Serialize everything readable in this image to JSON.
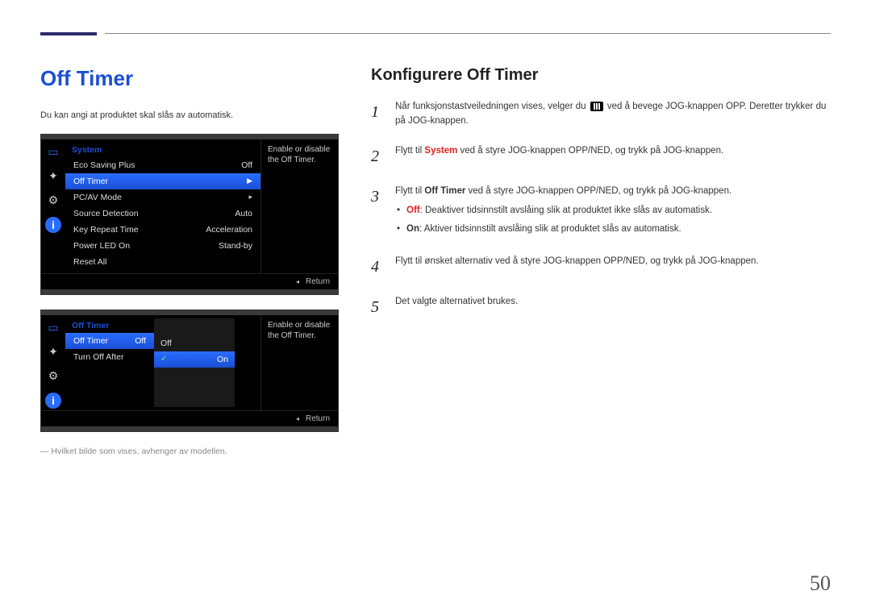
{
  "pageNumber": "50",
  "left": {
    "title": "Off Timer",
    "intro": "Du kan angi at produktet skal slås av automatisk.",
    "footnote": "― Hvilket bilde som vises, avhenger av modellen."
  },
  "osd1": {
    "header": "System",
    "help": "Enable or disable the Off Timer.",
    "rows": [
      {
        "label": "Eco Saving Plus",
        "value": "Off"
      },
      {
        "label": "Off Timer",
        "value": "▶",
        "selected": true
      },
      {
        "label": "PC/AV Mode",
        "value": "▸"
      },
      {
        "label": "Source Detection",
        "value": "Auto"
      },
      {
        "label": "Key Repeat Time",
        "value": "Acceleration"
      },
      {
        "label": "Power LED On",
        "value": "Stand-by"
      },
      {
        "label": "Reset All",
        "value": ""
      }
    ],
    "return": "Return"
  },
  "osd2": {
    "header": "Off Timer",
    "help": "Enable or disable the Off Timer.",
    "colA": [
      {
        "label": "Off Timer",
        "value": "Off",
        "selected": true
      },
      {
        "label": "Turn Off After",
        "value": ""
      }
    ],
    "colB": [
      {
        "label": "Off",
        "selected": false
      },
      {
        "label": "On",
        "selected": true
      }
    ],
    "return": "Return"
  },
  "right": {
    "title": "Konfigurere Off Timer",
    "steps": [
      {
        "n": "1",
        "pre": "Når funksjonstastveiledningen vises, velger du ",
        "post": " ved å bevege JOG-knappen OPP. Deretter trykker du på JOG-knappen.",
        "hasIcon": true
      },
      {
        "n": "2",
        "pre": "Flytt til ",
        "kw": "System",
        "post": " ved å styre JOG-knappen OPP/NED, og trykk på JOG-knappen.",
        "kwRed": true
      },
      {
        "n": "3",
        "pre": "Flytt til ",
        "kw": "Off Timer",
        "post": " ved å styre JOG-knappen OPP/NED, og trykk på JOG-knappen.",
        "kwRed": false,
        "bullets": [
          {
            "kw": "Off",
            "kwRed": true,
            "text": ": Deaktiver tidsinnstilt avslåing slik at produktet ikke slås av automatisk."
          },
          {
            "kw": "On",
            "kwRed": false,
            "text": ": Aktiver tidsinnstilt avslåing slik at produktet slås av automatisk."
          }
        ]
      },
      {
        "n": "4",
        "plain": "Flytt til ønsket alternativ ved å styre JOG-knappen OPP/NED, og trykk på JOG-knappen."
      },
      {
        "n": "5",
        "plain": "Det valgte alternativet brukes."
      }
    ]
  }
}
